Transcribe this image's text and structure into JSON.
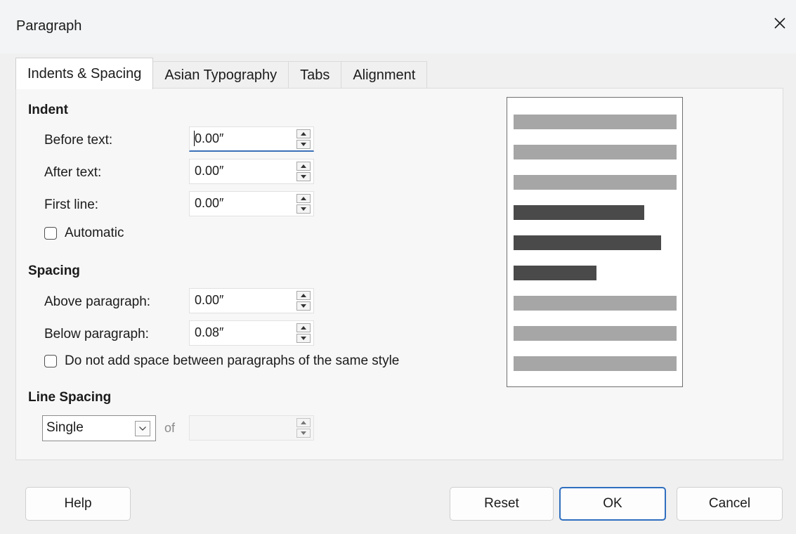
{
  "window": {
    "title": "Paragraph"
  },
  "tabs": [
    {
      "label": "Indents & Spacing",
      "active": true
    },
    {
      "label": "Asian Typography",
      "active": false
    },
    {
      "label": "Tabs",
      "active": false
    },
    {
      "label": "Alignment",
      "active": false
    }
  ],
  "indent": {
    "title": "Indent",
    "before_text": {
      "label": "Before text:",
      "value": "0.00″"
    },
    "after_text": {
      "label": "After text:",
      "value": "0.00″"
    },
    "first_line": {
      "label": "First line:",
      "value": "0.00″"
    },
    "automatic": {
      "label": "Automatic",
      "checked": false
    }
  },
  "spacing": {
    "title": "Spacing",
    "above_paragraph": {
      "label": "Above paragraph:",
      "value": "0.00″"
    },
    "below_paragraph": {
      "label": "Below paragraph:",
      "value": "0.08″"
    },
    "no_space_same_style": {
      "label": "Do not add space between paragraphs of the same style",
      "checked": false
    }
  },
  "line_spacing": {
    "title": "Line Spacing",
    "selected": "Single",
    "of_label": "of",
    "of_value": ""
  },
  "buttons": {
    "help": "Help",
    "reset": "Reset",
    "ok": "OK",
    "cancel": "Cancel"
  },
  "colors": {
    "accent": "#2f6fbf",
    "preview_light": "#a6a6a6",
    "preview_dark": "#4a4a4a"
  }
}
